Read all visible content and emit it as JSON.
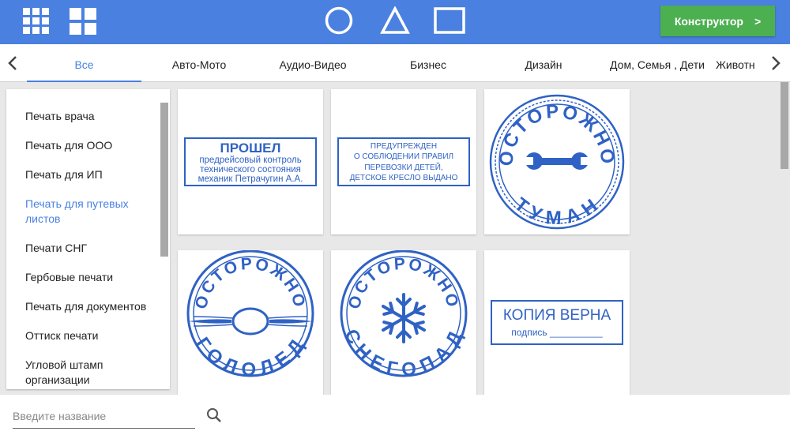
{
  "topbar": {
    "constructor_label": "Конструктор",
    "constructor_arrow": ">",
    "icons": [
      "apps-grid-icon",
      "dashboard-icon",
      "circle-shape-icon",
      "triangle-shape-icon",
      "square-shape-icon"
    ]
  },
  "tabs": [
    {
      "label": "Все",
      "active": true
    },
    {
      "label": "Авто-Мото"
    },
    {
      "label": "Аудио-Видео"
    },
    {
      "label": "Бизнес"
    },
    {
      "label": "Дизайн"
    },
    {
      "label": "Дом, Семья , Дети"
    },
    {
      "label": "Животн"
    }
  ],
  "sidebar": {
    "items": [
      {
        "label": "Печать врача"
      },
      {
        "label": "Печать для ООО"
      },
      {
        "label": "Печать для ИП"
      },
      {
        "label": "Печать для путевых листов",
        "active": true
      },
      {
        "label": "Печати СНГ"
      },
      {
        "label": "Гербовые печати"
      },
      {
        "label": "Печать для документов"
      },
      {
        "label": "Оттиск печати"
      },
      {
        "label": "Угловой штамп организации"
      }
    ]
  },
  "stamps": {
    "s1": {
      "line1": "ПРОШЕЛ",
      "line2": "предрейсовый контроль",
      "line3": "технического состояния",
      "line4": "механик Петрачугин А.А."
    },
    "s2": {
      "line1": "ПРЕДУПРЕЖДЕН",
      "line2": "О СОБЛЮДЕНИИ ПРАВИЛ",
      "line3": "ПЕРЕВОЗКИ ДЕТЕЙ,",
      "line4": "ДЕТСКОЕ КРЕСЛО ВЫДАНО"
    },
    "s3": {
      "top": "ОСТОРОЖНО",
      "bottom": "ТУМАН"
    },
    "s4": {
      "top": "ОСТОРОЖНО",
      "bottom": "ГОЛОЛЕД"
    },
    "s5": {
      "top": "ОСТОРОЖНО",
      "bottom": "СНЕГОПАД"
    },
    "s6": {
      "line1": "КОПИЯ ВЕРНА",
      "line2": "подпись __________"
    }
  },
  "search": {
    "placeholder": "Введите название"
  },
  "colors": {
    "topbar": "#4a80e0",
    "accent": "#4a80e0",
    "stamp": "#2f62c4",
    "constructor": "#4caf50"
  }
}
